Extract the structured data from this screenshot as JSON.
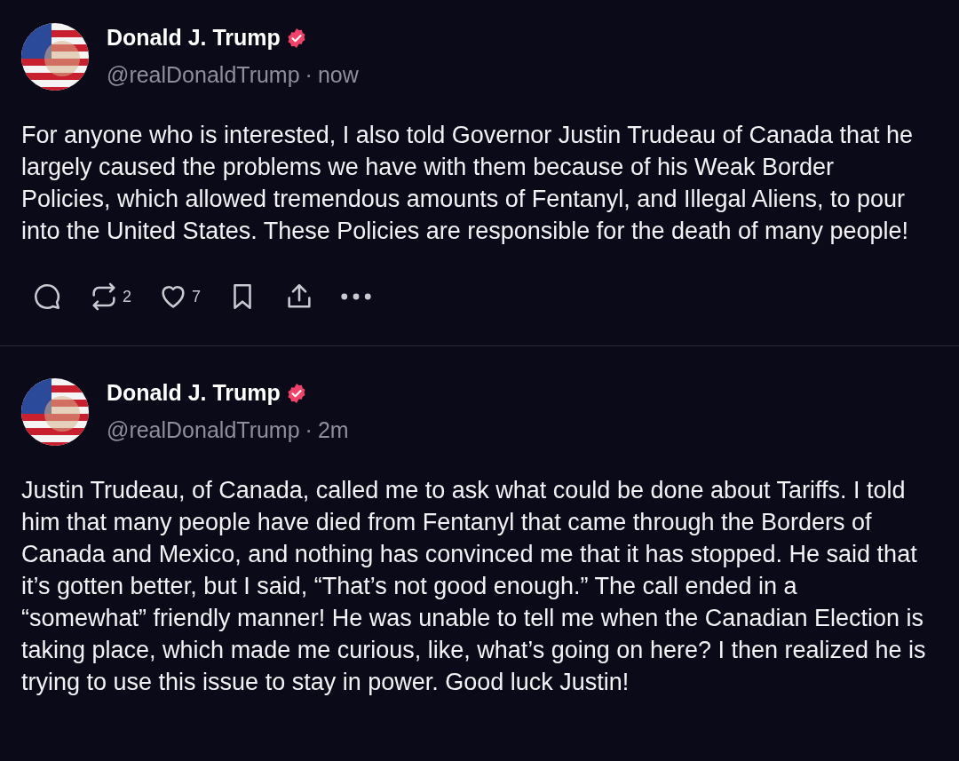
{
  "posts": [
    {
      "author": "Donald J. Trump",
      "verified": true,
      "handle": "@realDonaldTrump",
      "separator": "·",
      "time": "now",
      "body": "For anyone who is interested, I also told Governor Justin Trudeau of Canada that he largely caused the problems we have with them because of his Weak Border Policies, which allowed tremendous amounts of Fentanyl, and Illegal Aliens, to pour into the United States. These Policies are responsible for the death of many people!",
      "actions": {
        "repost_count": "2",
        "like_count": "7"
      }
    },
    {
      "author": "Donald J. Trump",
      "verified": true,
      "handle": "@realDonaldTrump",
      "separator": "·",
      "time": "2m",
      "body": "Justin Trudeau, of Canada, called me to ask what could be done about Tariffs. I told him that many people have died from Fentanyl that came through the Borders of Canada and Mexico, and nothing has convinced me that it has stopped. He said that it’s gotten better, but I said, “That’s not good enough.” The call ended in a “somewhat” friendly manner! He was unable to tell me when the Canadian Election is taking place, which made me curious, like, what’s going on here? I then realized he is trying to use this issue to stay in power. Good luck Justin!"
    }
  ]
}
